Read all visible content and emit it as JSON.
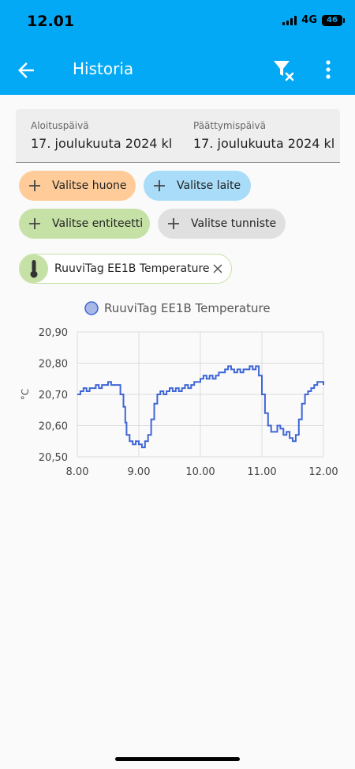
{
  "status_bar": {
    "time": "12.01",
    "network": "4G",
    "battery": "46"
  },
  "app_bar": {
    "title": "Historia",
    "icons": [
      "arrow-left-icon",
      "filter-remove-icon",
      "more-vert-icon"
    ]
  },
  "date_range": {
    "start_label": "Aloituspäivä",
    "start_value": "17. joulukuuta 2024 kl",
    "end_label": "Päättymispäivä",
    "end_value": "17. joulukuuta 2024 kl"
  },
  "chips": {
    "room": {
      "label": "Valitse huone",
      "color": "#ffcc99"
    },
    "device": {
      "label": "Valitse laite",
      "color": "#a8dcf8"
    },
    "entity": {
      "label": "Valitse entiteetti",
      "color": "#c5e1a5"
    },
    "tag": {
      "label": "Valitse tunniste",
      "color": "#e0e0e0"
    }
  },
  "selected_entity": {
    "label": "RuuviTag EE1B Temperature",
    "icon": "thermometer-icon"
  },
  "chart_data": {
    "type": "line",
    "legend": [
      "RuuviTag EE1B Temperature"
    ],
    "legend_position": "top",
    "ylabel": "°C",
    "xlabel": "",
    "xlim": [
      8.0,
      12.0
    ],
    "ylim": [
      20.5,
      20.9
    ],
    "x_ticks": [
      "8.00",
      "9.00",
      "10.00",
      "11.00",
      "12.00"
    ],
    "y_ticks": [
      "20,90",
      "20,80",
      "20,70",
      "20,60",
      "20,50"
    ],
    "grid": true,
    "color": "#3f66d6",
    "series": [
      {
        "name": "RuuviTag EE1B Temperature",
        "points": [
          [
            8.0,
            20.7
          ],
          [
            8.05,
            20.71
          ],
          [
            8.1,
            20.72
          ],
          [
            8.15,
            20.71
          ],
          [
            8.2,
            20.72
          ],
          [
            8.25,
            20.72
          ],
          [
            8.3,
            20.73
          ],
          [
            8.35,
            20.72
          ],
          [
            8.4,
            20.73
          ],
          [
            8.45,
            20.73
          ],
          [
            8.5,
            20.74
          ],
          [
            8.55,
            20.73
          ],
          [
            8.6,
            20.73
          ],
          [
            8.65,
            20.73
          ],
          [
            8.7,
            20.7
          ],
          [
            8.75,
            20.66
          ],
          [
            8.78,
            20.61
          ],
          [
            8.8,
            20.57
          ],
          [
            8.85,
            20.55
          ],
          [
            8.9,
            20.54
          ],
          [
            8.95,
            20.55
          ],
          [
            9.0,
            20.54
          ],
          [
            9.05,
            20.53
          ],
          [
            9.1,
            20.55
          ],
          [
            9.15,
            20.57
          ],
          [
            9.2,
            20.62
          ],
          [
            9.25,
            20.67
          ],
          [
            9.3,
            20.7
          ],
          [
            9.35,
            20.71
          ],
          [
            9.4,
            20.7
          ],
          [
            9.45,
            20.71
          ],
          [
            9.5,
            20.72
          ],
          [
            9.55,
            20.71
          ],
          [
            9.6,
            20.72
          ],
          [
            9.65,
            20.71
          ],
          [
            9.7,
            20.72
          ],
          [
            9.75,
            20.73
          ],
          [
            9.8,
            20.72
          ],
          [
            9.85,
            20.73
          ],
          [
            9.9,
            20.74
          ],
          [
            9.95,
            20.74
          ],
          [
            10.0,
            20.75
          ],
          [
            10.05,
            20.76
          ],
          [
            10.1,
            20.75
          ],
          [
            10.15,
            20.76
          ],
          [
            10.2,
            20.75
          ],
          [
            10.25,
            20.76
          ],
          [
            10.3,
            20.77
          ],
          [
            10.35,
            20.77
          ],
          [
            10.4,
            20.78
          ],
          [
            10.45,
            20.79
          ],
          [
            10.5,
            20.78
          ],
          [
            10.55,
            20.77
          ],
          [
            10.6,
            20.78
          ],
          [
            10.65,
            20.77
          ],
          [
            10.7,
            20.78
          ],
          [
            10.75,
            20.78
          ],
          [
            10.8,
            20.79
          ],
          [
            10.85,
            20.78
          ],
          [
            10.9,
            20.79
          ],
          [
            10.95,
            20.76
          ],
          [
            11.0,
            20.7
          ],
          [
            11.05,
            20.64
          ],
          [
            11.1,
            20.6
          ],
          [
            11.15,
            20.58
          ],
          [
            11.2,
            20.58
          ],
          [
            11.25,
            20.6
          ],
          [
            11.3,
            20.59
          ],
          [
            11.35,
            20.57
          ],
          [
            11.4,
            20.58
          ],
          [
            11.45,
            20.56
          ],
          [
            11.5,
            20.55
          ],
          [
            11.55,
            20.57
          ],
          [
            11.6,
            20.62
          ],
          [
            11.65,
            20.67
          ],
          [
            11.7,
            20.7
          ],
          [
            11.75,
            20.71
          ],
          [
            11.8,
            20.72
          ],
          [
            11.85,
            20.73
          ],
          [
            11.9,
            20.74
          ],
          [
            11.95,
            20.74
          ],
          [
            12.0,
            20.73
          ]
        ]
      }
    ]
  }
}
